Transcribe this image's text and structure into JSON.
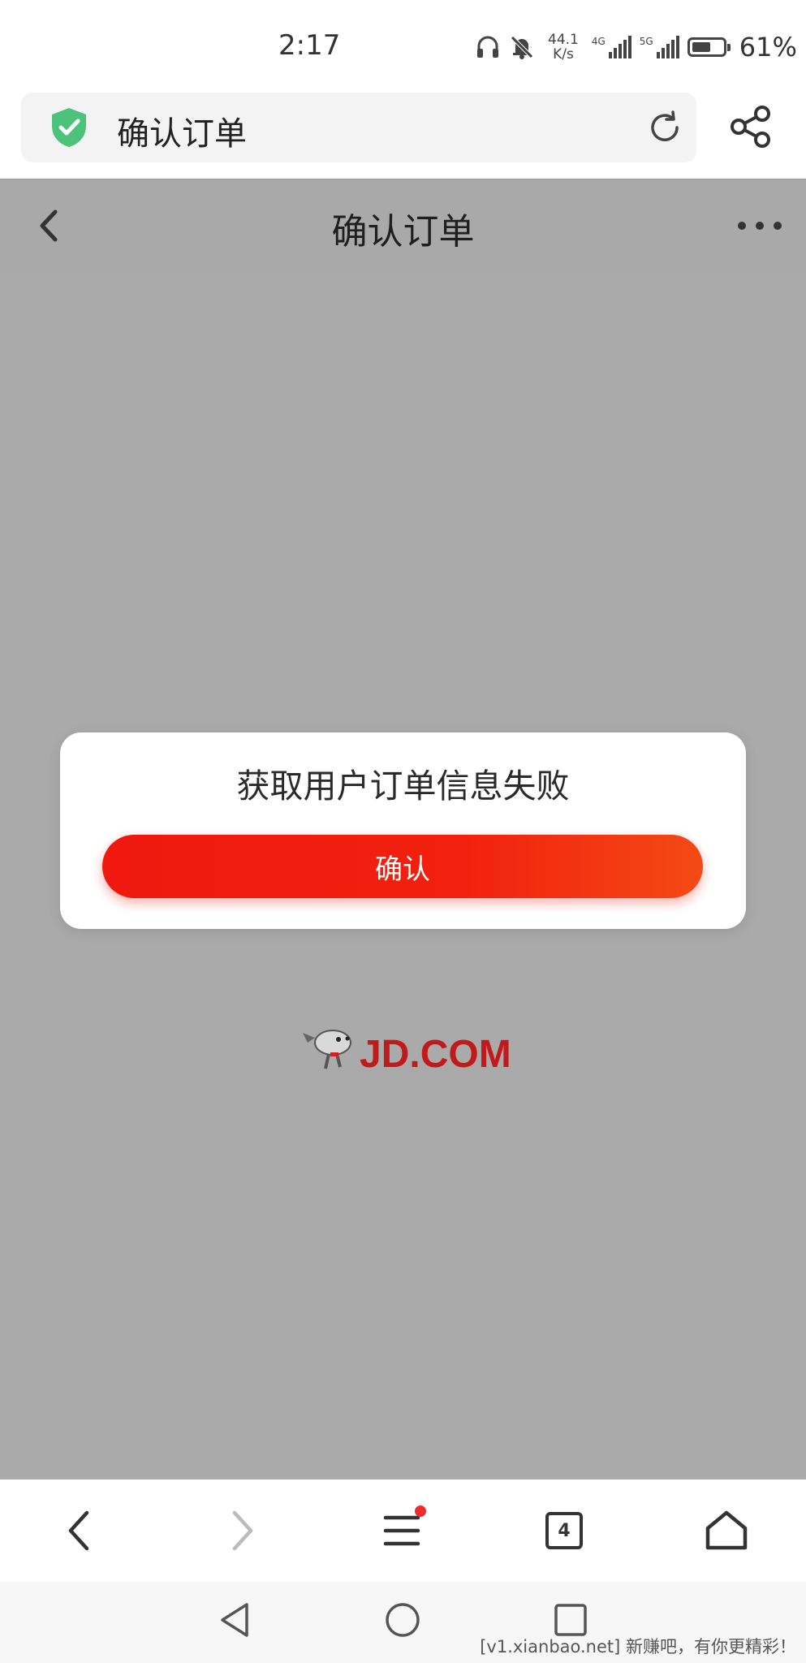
{
  "status_bar": {
    "time": "2:17",
    "net_speed_value": "44.1",
    "net_speed_unit": "K/s",
    "sim1_tag": "4G",
    "sim2_tag": "5G",
    "battery_percent": "61%",
    "battery_level": 0.61
  },
  "browser": {
    "url_title": "确认订单",
    "security_status": "secure",
    "colors": {
      "shield": "#4cc27a"
    }
  },
  "page": {
    "title": "确认订单"
  },
  "dialog": {
    "message": "获取用户订单信息失败",
    "confirm_label": "确认",
    "colors": {
      "button_start": "#f0180f",
      "button_end": "#f34a14"
    }
  },
  "logo": {
    "text": "JD.COM"
  },
  "toolbar": {
    "tab_count": "4",
    "menu_has_notification": true,
    "forward_enabled": false
  },
  "watermark": {
    "text": "[v1.xianbao.net] 新赚吧，有你更精彩！"
  }
}
